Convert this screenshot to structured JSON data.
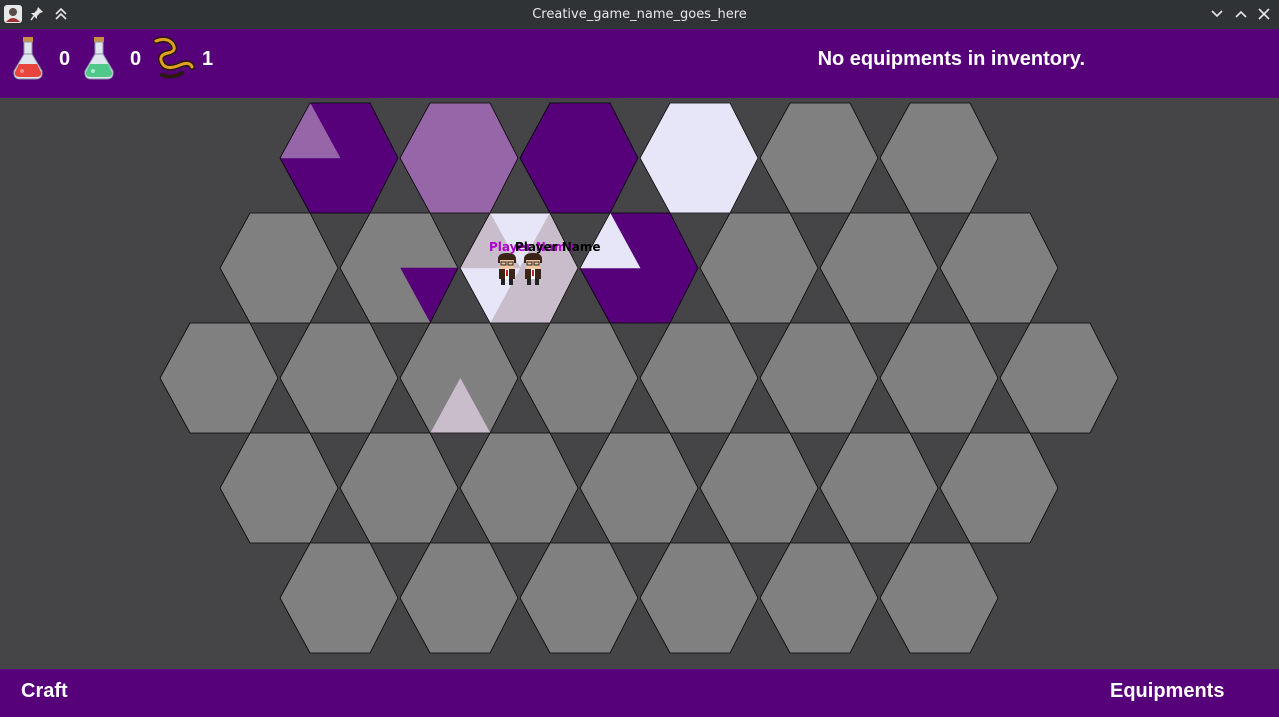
{
  "window": {
    "title": "Creative_game_name_goes_here"
  },
  "hud": {
    "red_potion": {
      "icon": "red-potion-icon",
      "count": "0"
    },
    "green_potion": {
      "icon": "green-potion-icon",
      "count": "0"
    },
    "rope": {
      "icon": "rope-icon",
      "count": "1"
    },
    "inventory_message": "No equipments in inventory."
  },
  "players": [
    {
      "name": "Player Name",
      "name_color": "#b000d0"
    },
    {
      "name": "Player Name",
      "name_color": "#000000"
    }
  ],
  "bottom": {
    "craft_label": "Craft",
    "equipments_label": "Equipments"
  },
  "colors": {
    "accent": "#56007a",
    "board_background": "#454447",
    "tile_gray": "#808080",
    "tile_purple": "#56007a",
    "tile_lilac": "#9666a8",
    "tile_pale": "#e6e6f8",
    "tile_mauve": "#c9bccb"
  }
}
